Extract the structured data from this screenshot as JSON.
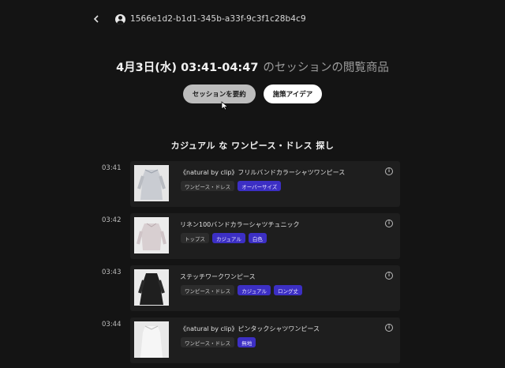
{
  "header": {
    "back_icon": "chevron-left-icon",
    "user_icon": "user-circle-icon",
    "session_id": "1566e1d2-b1d1-345b-a33f-9c3f1c28b4c9"
  },
  "title": {
    "date_time": "4月3日(水) 03:41-04:47",
    "suffix": "のセッションの閲覧商品"
  },
  "actions": {
    "summarize_label": "セッションを要約",
    "ideas_label": "施策アイデア"
  },
  "section": {
    "title": "カジュアル な ワンピース・ドレス 探し"
  },
  "items": [
    {
      "time": "03:41",
      "name": "《natural by clip》フリルバンドカラーシャツワンピース",
      "tags": [
        {
          "label": "ワンピース・ドレス",
          "style": "gray"
        },
        {
          "label": "オーバーサイズ",
          "style": "blue"
        }
      ]
    },
    {
      "time": "03:42",
      "name": "リネン100バンドカラーシャツチュニック",
      "tags": [
        {
          "label": "トップス",
          "style": "gray"
        },
        {
          "label": "カジュアル",
          "style": "blue"
        },
        {
          "label": "白色",
          "style": "blue"
        }
      ]
    },
    {
      "time": "03:43",
      "name": "ステッチワークワンピース",
      "tags": [
        {
          "label": "ワンピース・ドレス",
          "style": "gray"
        },
        {
          "label": "カジュアル",
          "style": "blue"
        },
        {
          "label": "ロング丈",
          "style": "blue"
        }
      ]
    },
    {
      "time": "03:44",
      "name": "《natural by clip》ピンタックシャツワンピース",
      "tags": [
        {
          "label": "ワンピース・ドレス",
          "style": "gray"
        },
        {
          "label": "無地",
          "style": "blue"
        }
      ]
    }
  ],
  "colors": {
    "background": "#141414",
    "card": "#1e1e1e",
    "tag_accent": "#3c2fc4"
  }
}
